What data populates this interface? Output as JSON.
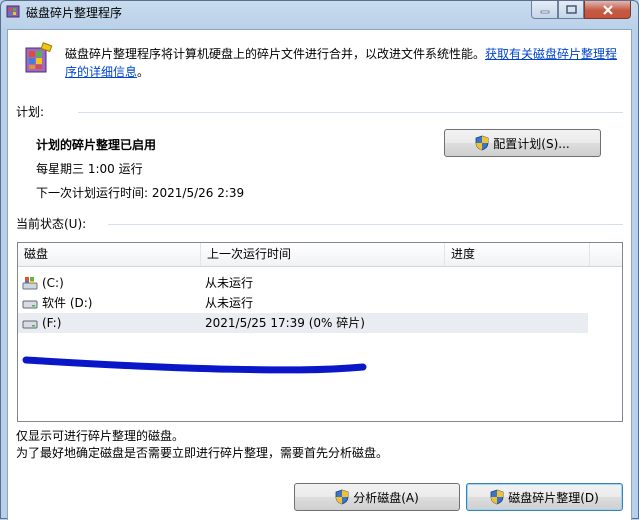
{
  "window": {
    "title": "磁盘碎片整理程序",
    "controls": {
      "minimize": "—",
      "maximize": "□",
      "close": "✕"
    }
  },
  "intro": {
    "text": "磁盘碎片整理程序将计算机硬盘上的碎片文件进行合并，以改进文件系统性能。",
    "link": "获取有关磁盘碎片整理程序的详细信息",
    "link_suffix": "。"
  },
  "schedule": {
    "section_label": "计划:",
    "status": "计划的碎片整理已启用",
    "frequency": "每星期三  1:00 运行",
    "next_run": "下一次计划运行时间: 2021/5/26 2:39",
    "configure_button": "配置计划(S)..."
  },
  "current_status": {
    "section_label": "当前状态(U):",
    "columns": [
      "磁盘",
      "上一次运行时间",
      "进度"
    ],
    "rows": [
      {
        "disk": "(C:)",
        "last_run": "从未运行",
        "progress": "",
        "icon": "system-drive-icon"
      },
      {
        "disk": "软件 (D:)",
        "last_run": "从未运行",
        "progress": "",
        "icon": "drive-icon"
      },
      {
        "disk": "(F:)",
        "last_run": "2021/5/25 17:39 (0% 碎片)",
        "progress": "",
        "icon": "drive-icon"
      }
    ]
  },
  "footer": {
    "note1": "仅显示可进行碎片整理的磁盘。",
    "note2": "为了最好地确定磁盘是否需要立即进行碎片整理，需要首先分析磁盘。",
    "analyze_button": "分析磁盘(A)",
    "defrag_button": "磁盘碎片整理(D)"
  },
  "colors": {
    "selected_row": "#e9ecf0",
    "link": "#0044cc",
    "annotation_stroke": "#0a17c8"
  }
}
